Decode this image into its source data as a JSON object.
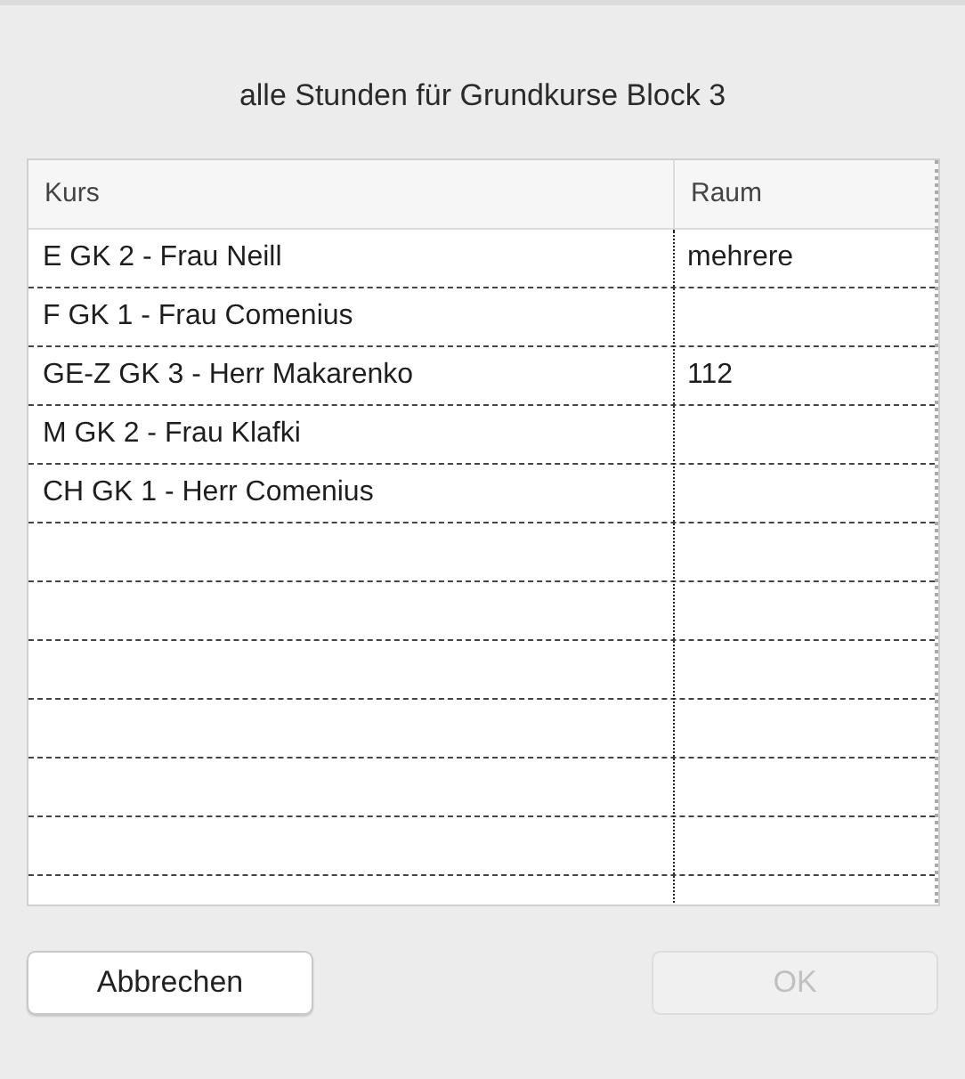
{
  "dialog": {
    "title": "alle Stunden für Grundkurse Block 3"
  },
  "table": {
    "columns": [
      "Kurs",
      "Raum"
    ],
    "rows": [
      [
        "E GK 2 - Frau Neill",
        "mehrere"
      ],
      [
        "F GK 1 - Frau Comenius",
        ""
      ],
      [
        "GE-Z GK 3 - Herr Makarenko",
        "112"
      ],
      [
        "M GK 2 - Frau Klafki",
        ""
      ],
      [
        "CH GK 1 - Herr Comenius",
        ""
      ]
    ]
  },
  "buttons": [
    {
      "label": "Abbrechen",
      "disabled": false
    },
    {
      "label": "OK",
      "disabled": true
    }
  ]
}
